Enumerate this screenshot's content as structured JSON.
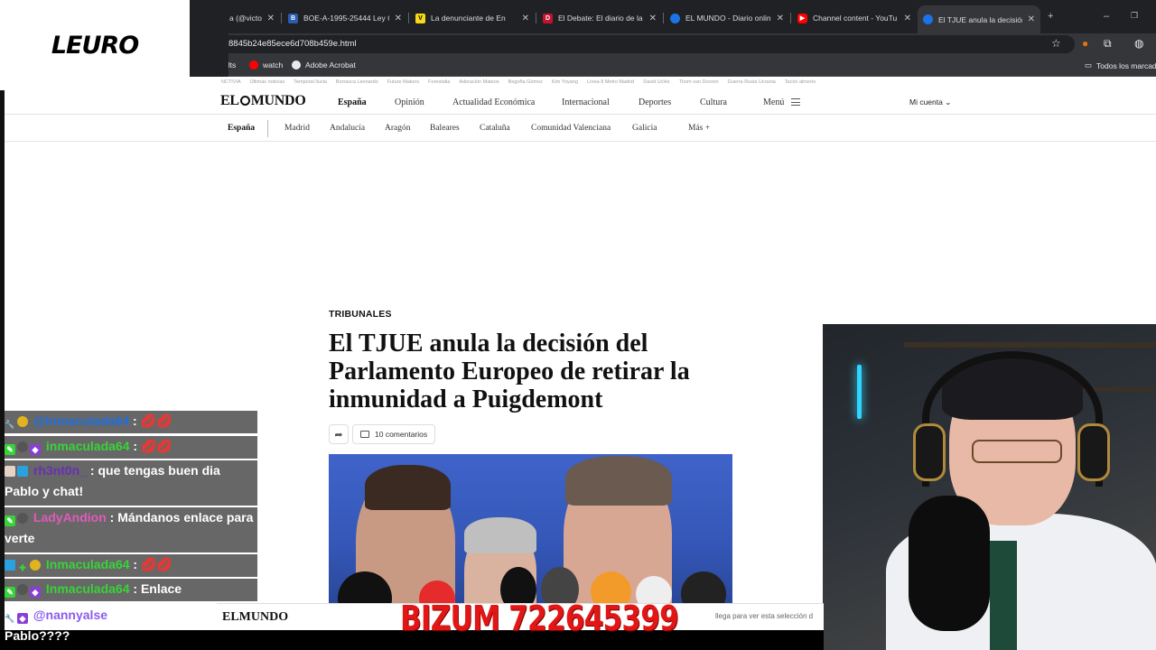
{
  "overlay_logo": "LEURO",
  "browser": {
    "tabs": [
      {
        "title": "a (@victo",
        "color": "#202124"
      },
      {
        "title": "BOE-A-1995-25444 Ley O",
        "color": "#2a5db0"
      },
      {
        "title": "La denunciante de En",
        "color": "#f7d917"
      },
      {
        "title": "El Debate: El diario de la a",
        "color": "#c4122f"
      },
      {
        "title": "EL MUNDO - Diario onlin",
        "color": "#1a73e8"
      },
      {
        "title": "Channel content - YouTu",
        "color": "#ff0000"
      },
      {
        "title": "El TJUE anula la decisión d",
        "color": "#1a73e8"
      }
    ],
    "url": "8845b24e85ece6d708b459e.html",
    "bookmarks": [
      "ults",
      "watch",
      "Adobe Acrobat"
    ],
    "all_bookmarks": "Todos los marcad"
  },
  "site": {
    "brand_left": "EL",
    "brand_right": "MUNDO",
    "trending": [
      "NCTIVIA",
      "Últimas noticias",
      "Temporal lluvia",
      "Borrasca Leonardo",
      "Future Makers",
      "Forestalia",
      "Adoración Mateos",
      "Begoña Gómez",
      "Kim Yoyang",
      "Línea 8 Metro Madrid",
      "David Uclés",
      "Thom van Dooren",
      "Guerra Rusia Ucrania",
      "Tacón almerío"
    ],
    "nav": [
      "España",
      "Opinión",
      "Actualidad Económica",
      "Internacional",
      "Deportes",
      "Cultura",
      "Menú"
    ],
    "account": "Mi cuenta",
    "subnav": [
      "España",
      "Madrid",
      "Andalucía",
      "Aragón",
      "Baleares",
      "Cataluña",
      "Comunidad Valenciana",
      "Galicia",
      "Más"
    ],
    "kicker": "TRIBUNALES",
    "headline": "El TJUE anula la decisión del Parlamento Europeo de retirar la inmunidad a Puigdemont",
    "comments": "10 comentarios"
  },
  "chat": [
    {
      "user": "@Inmaculada64",
      "user_color": "#1e6fe0",
      "sep": " : ",
      "msg": "💋💋"
    },
    {
      "user": "inmaculada64",
      "user_color": "#37d437",
      "sep": " : ",
      "msg": "💋💋"
    },
    {
      "user": "rh3nt0n_",
      "user_color": "#6a2fb5",
      "sep": " : ",
      "msg": "que tengas buen dia Pablo y chat!"
    },
    {
      "user": "LadyAndion",
      "user_color": "#e05ab7",
      "sep": " : ",
      "msg": "Mándanos enlace para verte"
    },
    {
      "user": "Inmaculada64",
      "user_color": "#37d437",
      "sep": " : ",
      "msg": "💋💋"
    },
    {
      "user": "Inmaculada64",
      "user_color": "#37d437",
      "sep": " : ",
      "msg": "Enlace"
    },
    {
      "user": "@nannyalse",
      "user_color": "#8a5cf0",
      "sep": " : ",
      "msg": "Nos vamos a Allí Pablo????"
    }
  ],
  "bottom": {
    "brand": "ELMUNDO",
    "note": "llega para ver esta selección d",
    "bizum": "BIZUM 722645399"
  }
}
